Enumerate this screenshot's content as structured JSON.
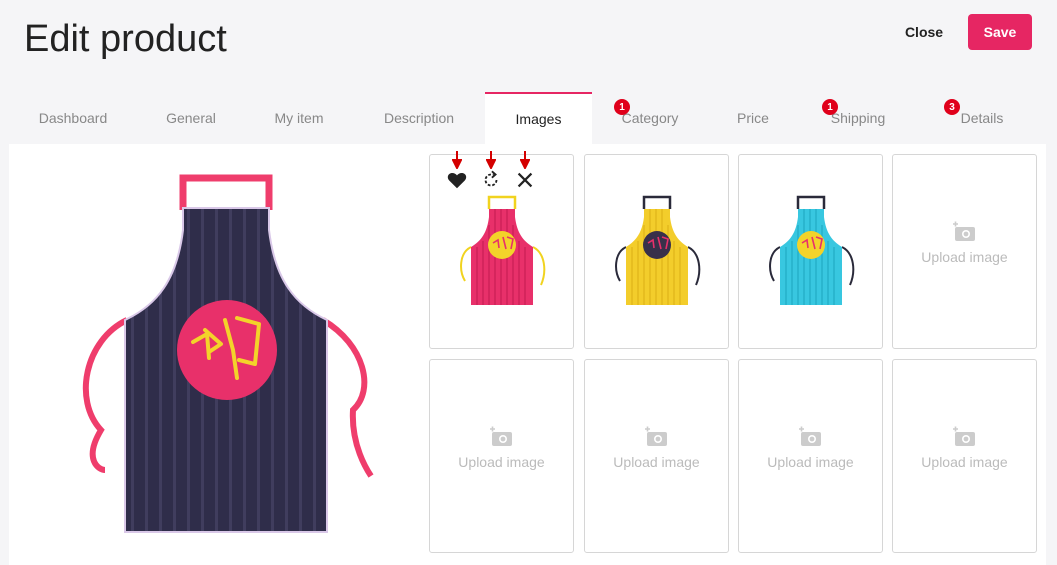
{
  "header": {
    "title": "Edit product",
    "close_label": "Close",
    "save_label": "Save"
  },
  "tabs": [
    {
      "label": "Dashboard",
      "badge": ""
    },
    {
      "label": "General",
      "badge": ""
    },
    {
      "label": "My item",
      "badge": ""
    },
    {
      "label": "Description",
      "badge": ""
    },
    {
      "label": "Images",
      "badge": "",
      "active": true
    },
    {
      "label": "Category",
      "badge": "1"
    },
    {
      "label": "Price",
      "badge": ""
    },
    {
      "label": "Shipping",
      "badge": "1"
    },
    {
      "label": "Details",
      "badge": "3"
    }
  ],
  "images": {
    "thumbnails": [
      {
        "color": "#e8306a",
        "stripe": "#c91e55",
        "strap": "#f1d31f",
        "logo_bg": "#f3d32a",
        "actions": [
          "heart-icon",
          "rotate-icon",
          "close-icon"
        ]
      },
      {
        "color": "#f3cd2b",
        "stripe": "#dfb51a",
        "strap": "#2a2a3a",
        "logo_bg": "#38304a"
      },
      {
        "color": "#38c7e0",
        "stripe": "#22aac4",
        "strap": "#2a2a3a",
        "logo_bg": "#f3d32a"
      }
    ],
    "upload_label": "Upload image"
  },
  "colors": {
    "accent": "#e62663",
    "badge": "#e0001b",
    "main_apron": "#2f2d4a",
    "main_strap": "#ef3d6c"
  }
}
